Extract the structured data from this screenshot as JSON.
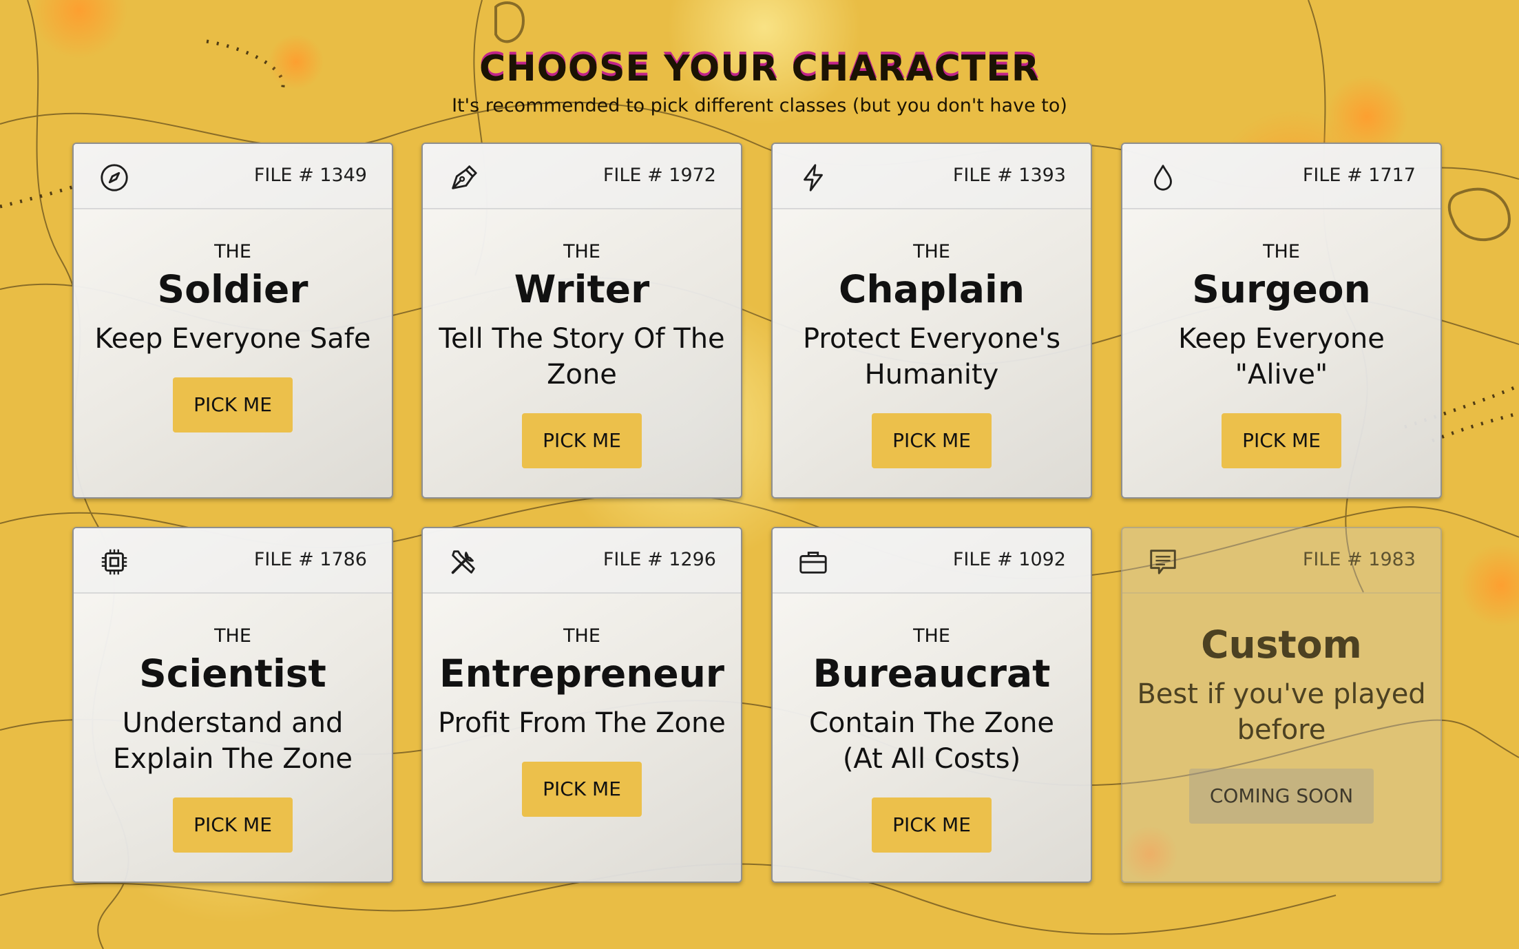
{
  "header": {
    "title": "CHOOSE YOUR CHARACTER",
    "subtitle": "It's recommended to pick different classes (but you don't have to)"
  },
  "theme": {
    "background": "#e9bd45",
    "button": "#ecc04b",
    "title_shadow": "#c0248a"
  },
  "cards": [
    {
      "file": "FILE # 1349",
      "the": "THE",
      "name": "Soldier",
      "tagline": "Keep Everyone Safe",
      "button": "PICK ME",
      "icon": "compass-icon"
    },
    {
      "file": "FILE # 1972",
      "the": "THE",
      "name": "Writer",
      "tagline": "Tell The Story Of The Zone",
      "button": "PICK ME",
      "icon": "pen-nib-icon"
    },
    {
      "file": "FILE # 1393",
      "the": "THE",
      "name": "Chaplain",
      "tagline": "Protect Everyone's Humanity",
      "button": "PICK ME",
      "icon": "lightning-icon"
    },
    {
      "file": "FILE # 1717",
      "the": "THE",
      "name": "Surgeon",
      "tagline": "Keep Everyone \"Alive\"",
      "button": "PICK ME",
      "icon": "droplet-icon"
    },
    {
      "file": "FILE # 1786",
      "the": "THE",
      "name": "Scientist",
      "tagline": "Understand and Explain The Zone",
      "button": "PICK ME",
      "icon": "chip-icon"
    },
    {
      "file": "FILE # 1296",
      "the": "THE",
      "name": "Entrepreneur",
      "tagline": "Profit From The Zone",
      "button": "PICK ME",
      "icon": "tools-icon"
    },
    {
      "file": "FILE # 1092",
      "the": "THE",
      "name": "Bureaucrat",
      "tagline": "Contain The Zone (At All Costs)",
      "button": "PICK ME",
      "icon": "briefcase-icon"
    },
    {
      "file": "FILE # 1983",
      "name": "Custom",
      "tagline": "Best if you've played before",
      "button": "COMING SOON",
      "icon": "message-icon"
    }
  ]
}
